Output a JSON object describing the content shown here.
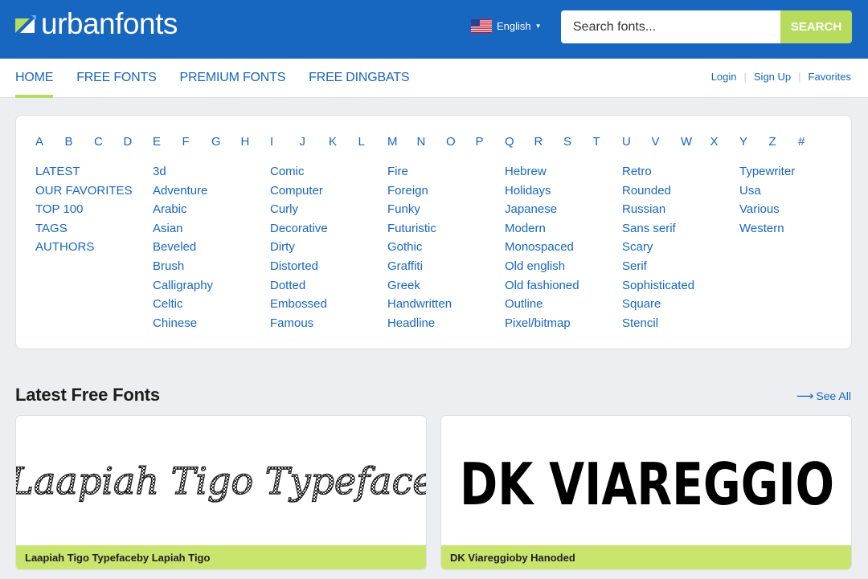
{
  "header": {
    "logo_text": "urbanfonts",
    "language": "English",
    "search_placeholder": "Search fonts...",
    "search_button": "SEARCH"
  },
  "nav": {
    "items": [
      "HOME",
      "FREE FONTS",
      "PREMIUM FONTS",
      "FREE DINGBATS"
    ],
    "active": "HOME",
    "aux": [
      "Login",
      "Sign Up",
      "Favorites"
    ]
  },
  "directory": {
    "letters": [
      "A",
      "B",
      "C",
      "D",
      "E",
      "F",
      "G",
      "H",
      "I",
      "J",
      "K",
      "L",
      "M",
      "N",
      "O",
      "P",
      "Q",
      "R",
      "S",
      "T",
      "U",
      "V",
      "W",
      "X",
      "Y",
      "Z",
      "#"
    ],
    "columns": [
      [
        "LATEST",
        "OUR FAVORITES",
        "TOP 100",
        "TAGS",
        "AUTHORS"
      ],
      [
        "3d",
        "Adventure",
        "Arabic",
        "Asian",
        "Beveled",
        "Brush",
        "Calligraphy",
        "Celtic",
        "Chinese"
      ],
      [
        "Comic",
        "Computer",
        "Curly",
        "Decorative",
        "Dirty",
        "Distorted",
        "Dotted",
        "Embossed",
        "Famous"
      ],
      [
        "Fire",
        "Foreign",
        "Funky",
        "Futuristic",
        "Gothic",
        "Graffiti",
        "Greek",
        "Handwritten",
        "Headline"
      ],
      [
        "Hebrew",
        "Holidays",
        "Japanese",
        "Modern",
        "Monospaced",
        "Old english",
        "Old fashioned",
        "Outline",
        "Pixel/bitmap"
      ],
      [
        "Retro",
        "Rounded",
        "Russian",
        "Sans serif",
        "Scary",
        "Serif",
        "Sophisticated",
        "Square",
        "Stencil"
      ],
      [
        "Typewriter",
        "Usa",
        "Various",
        "Western"
      ]
    ]
  },
  "latest": {
    "title": "Latest Free Fonts",
    "see_all": "See All",
    "cards": [
      {
        "preview_text": "Laapiah Tigo Typeface",
        "caption": "Laapiah Tigo Typefaceby Lapiah Tigo"
      },
      {
        "preview_text": "DK VIAREGGIO",
        "caption": "DK Viareggioby Hanoded"
      }
    ]
  },
  "colors": {
    "brand_blue": "#1766c0",
    "accent_green": "#b7dc5d",
    "caption_green": "#c9e56e",
    "page_bg": "#eceef2"
  }
}
